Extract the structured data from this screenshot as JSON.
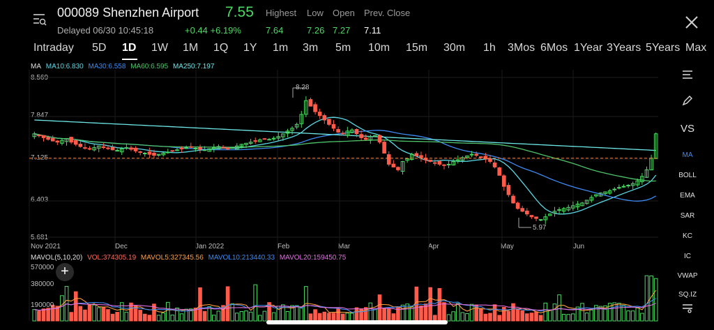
{
  "header": {
    "ticker": "000089 Shenzhen Airport",
    "price": "7.55",
    "status": "Delayed 06/30 10:45:18",
    "change": "+0.44 +6.19%",
    "quote": [
      {
        "label": "Highest",
        "value": "7.64",
        "color": "#4cd964"
      },
      {
        "label": "Low",
        "value": "7.26",
        "color": "#4cd964"
      },
      {
        "label": "Open",
        "value": "7.27",
        "color": "#4cd964"
      },
      {
        "label": "Prev. Close",
        "value": "7.11",
        "color": "#ffffff"
      }
    ]
  },
  "tabs": [
    "Intraday",
    "5D",
    "1D",
    "1W",
    "1M",
    "1Q",
    "1Y",
    "1m",
    "3m",
    "5m",
    "10m",
    "15m",
    "30m",
    "1h",
    "3Mos",
    "6Mos",
    "1Year",
    "3Years",
    "5Years",
    "Max"
  ],
  "active_tab": "1D",
  "ma_legend": {
    "label": "MA",
    "items": [
      {
        "text": "MA10:6.830",
        "color": "#5ad8e6"
      },
      {
        "text": "MA30:6.558",
        "color": "#3d8bf2"
      },
      {
        "text": "MA60:6.595",
        "color": "#4fc36a"
      },
      {
        "text": "MA250:7.197",
        "color": "#6ee7e7"
      }
    ]
  },
  "price_axis": [
    "8.569",
    "7.847",
    "7.125",
    "6.403",
    "5.681"
  ],
  "months": [
    "Nov 2021",
    "Dec",
    "Jan 2022",
    "Feb",
    "Mar",
    "Apr",
    "May",
    "Jun"
  ],
  "annotations": {
    "high": "8.28",
    "low": "5.97"
  },
  "side_menu": [
    "MA",
    "BOLL",
    "EMA",
    "SAR",
    "KC",
    "IC",
    "VWAP",
    "SQ.IZ"
  ],
  "side_labels": {
    "vs": "VS"
  },
  "vol_legend": {
    "label": "MAVOL(5,10,20)",
    "items": [
      {
        "text": "VOL:374305.19",
        "color": "#ff6b5b"
      },
      {
        "text": "MAVOL5:327345.56",
        "color": "#ff9f40"
      },
      {
        "text": "MAVOL10:213440.33",
        "color": "#3d8bf2"
      },
      {
        "text": "MAVOL20:159450.75",
        "color": "#e070e0"
      }
    ]
  },
  "vol_axis": [
    "570000",
    "380000",
    "190000"
  ],
  "colors": {
    "up": "#4cd964",
    "down": "#ff5a4a",
    "prevclose": "#ff7a30"
  },
  "chart_data": {
    "type": "candlestick",
    "ylim": [
      5.681,
      8.569
    ],
    "dashed_reference": 7.11,
    "closes": [
      7.55,
      7.52,
      7.48,
      7.45,
      7.42,
      7.4,
      7.43,
      7.46,
      7.4,
      7.36,
      7.32,
      7.3,
      7.28,
      7.3,
      7.33,
      7.31,
      7.29,
      7.26,
      7.25,
      7.28,
      7.3,
      7.27,
      7.24,
      7.22,
      7.2,
      7.18,
      7.16,
      7.18,
      7.2,
      7.22,
      7.24,
      7.26,
      7.28,
      7.3,
      7.31,
      7.29,
      7.27,
      7.26,
      7.28,
      7.3,
      7.32,
      7.3,
      7.28,
      7.3,
      7.33,
      7.36,
      7.38,
      7.4,
      7.42,
      7.44,
      7.46,
      7.45,
      7.47,
      7.5,
      7.55,
      7.6,
      7.65,
      7.72,
      7.9,
      8.15,
      8.05,
      7.95,
      7.88,
      7.8,
      7.72,
      7.65,
      7.58,
      7.55,
      7.6,
      7.62,
      7.55,
      7.48,
      7.45,
      7.5,
      7.52,
      7.4,
      7.2,
      7.0,
      6.95,
      6.9,
      7.05,
      7.1,
      7.18,
      7.15,
      7.12,
      7.08,
      7.05,
      7.02,
      7.0,
      6.98,
      7.0,
      7.05,
      7.08,
      7.12,
      7.15,
      7.18,
      7.16,
      7.12,
      7.1,
      7.05,
      6.95,
      6.8,
      6.6,
      6.45,
      6.3,
      6.2,
      6.15,
      6.1,
      6.05,
      6.02,
      6.0,
      6.05,
      6.1,
      6.15,
      6.18,
      6.2,
      6.22,
      6.25,
      6.28,
      6.3,
      6.35,
      6.4,
      6.45,
      6.48,
      6.5,
      6.52,
      6.55,
      6.58,
      6.6,
      6.62,
      6.65,
      6.7,
      6.78,
      6.9,
      7.11,
      7.55
    ]
  }
}
